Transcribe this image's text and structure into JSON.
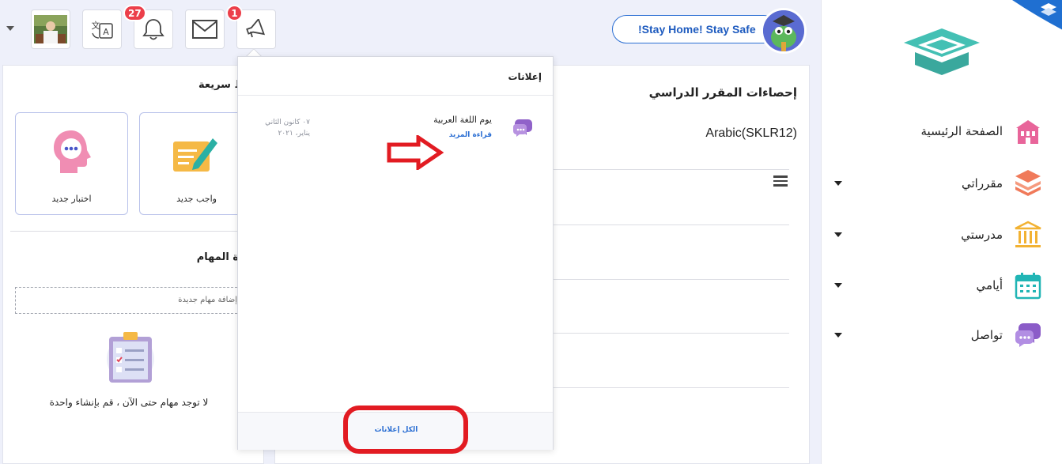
{
  "topbar": {
    "notifications_count": "27",
    "announcements_count": "1",
    "stay_home": "!Stay Home! Stay Safe"
  },
  "sidebar": {
    "items": [
      {
        "label": "الصفحة الرئيسية",
        "icon": "school-building-icon",
        "color": "#e8659a"
      },
      {
        "label": "مقرراتي",
        "icon": "books-stack-icon",
        "color": "#f07a5a"
      },
      {
        "label": "مدرستي",
        "icon": "institution-icon",
        "color": "#f2b233"
      },
      {
        "label": "أيامي",
        "icon": "calendar-icon",
        "color": "#21b5b5"
      },
      {
        "label": "تواصل",
        "icon": "chat-bubbles-icon",
        "color": "#8b5cc8"
      }
    ]
  },
  "main": {
    "stats_title": "إحصاءات المقرر الدراسي",
    "course": "Arabic(SKLR12)"
  },
  "quick": {
    "title": "ط سريعة",
    "new_homework": "واجب جديد",
    "new_quiz": "اختبار جديد"
  },
  "tasks": {
    "title": "ة المهام",
    "add_placeholder": "إضافة مهام جديدة",
    "empty_message": "لا توجد مهام حتى الآن ، قم بإنشاء واحدة"
  },
  "announcements": {
    "title": "إعلانات",
    "item_title": "يوم اللغة العربية",
    "item_link": "قراءة المزيد",
    "item_date_line1": "٠٧ كانون الثاني",
    "item_date_line2": "يناير، ٢٠٢١",
    "all_label": "الكل إعلانات"
  },
  "colors": {
    "accent": "#2c6fd3",
    "badge": "#ec3f4a",
    "highlight_red": "#e21b22"
  }
}
